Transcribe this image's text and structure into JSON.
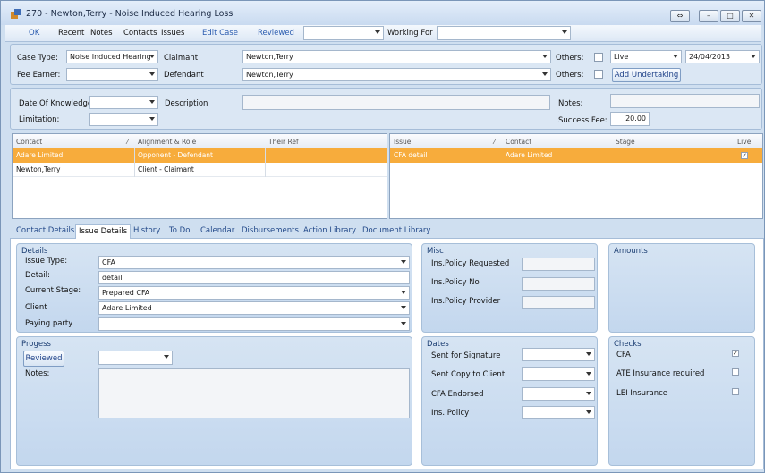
{
  "window": {
    "title": "270 - Newton,Terry - Noise Induced Hearing Loss"
  },
  "toolbar": {
    "ok": "OK",
    "recent": "Recent",
    "notes": "Notes",
    "contacts": "Contacts",
    "issues": "Issues",
    "edit_case": "Edit Case",
    "reviewed": "Reviewed",
    "working_for": "Working For"
  },
  "case": {
    "case_type_label": "Case Type:",
    "case_type_value": "Noise Induced Hearing",
    "fee_earner_label": "Fee Earner:",
    "claimant_label": "Claimant",
    "claimant_value": "Newton,Terry",
    "defendant_label": "Defendant",
    "defendant_value": "Newton,Terry",
    "others_label_1": "Others:",
    "others_label_2": "Others:",
    "status_value": "Live",
    "date_value": "24/04/2013",
    "add_undertaking": "Add Undertaking"
  },
  "knowledge": {
    "date_label": "Date Of Knowledge",
    "limitation_label": "Limitation:",
    "description_label": "Description",
    "notes_label": "Notes:",
    "success_fee_label": "Success Fee:",
    "success_fee_value": "20.00"
  },
  "contacts_grid": {
    "headers": [
      "Contact",
      "Alignment & Role",
      "Their Ref"
    ],
    "rows": [
      {
        "contact": "Adare Limited",
        "role": "Opponent - Defendant",
        "ref": ""
      },
      {
        "contact": "Newton,Terry",
        "role": "Client - Claimant",
        "ref": ""
      }
    ]
  },
  "issues_grid": {
    "headers": [
      "Issue",
      "Contact",
      "Stage",
      "Live"
    ],
    "rows": [
      {
        "issue": "CFA detail",
        "contact": "Adare Limited",
        "stage": "",
        "live": "✓"
      }
    ]
  },
  "tabs": [
    "Contact Details",
    "Issue Details",
    "History",
    "To Do",
    "Calendar",
    "Disbursements",
    "Action Library",
    "Document Library"
  ],
  "details": {
    "title": "Details",
    "issue_type_label": "Issue Type:",
    "issue_type_value": "CFA",
    "detail_label": "Detail:",
    "detail_value": "detail",
    "stage_label": "Current Stage:",
    "stage_value": "Prepared CFA",
    "client_label": "Client",
    "client_value": "Adare Limited",
    "paying_label": "Paying party"
  },
  "misc": {
    "title": "Misc",
    "policy_requested": "Ins.Policy Requested",
    "policy_no": "Ins.Policy No",
    "policy_provider": "Ins.Policy Provider"
  },
  "amounts": {
    "title": "Amounts"
  },
  "progress": {
    "title": "Progess",
    "reviewed": "Reviewed",
    "notes_label": "Notes:"
  },
  "dates": {
    "title": "Dates",
    "sent_signature": "Sent for Signature",
    "sent_copy": "Sent Copy to Client",
    "cfa_endorsed": "CFA Endorsed",
    "ins_policy": "Ins. Policy"
  },
  "checks": {
    "title": "Checks",
    "cfa": "CFA",
    "cfa_checked": "✓",
    "ate": "ATE Insurance required",
    "lei": "LEI Insurance"
  },
  "window_buttons": {
    "restore": "⇔",
    "min": "–",
    "max": "□",
    "close": "✕"
  }
}
